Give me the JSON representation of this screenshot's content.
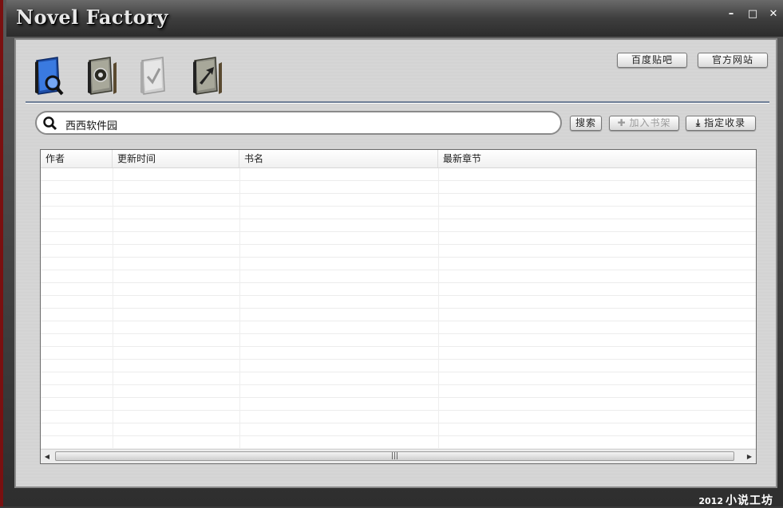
{
  "app": {
    "title": "Novel Factory",
    "window_controls": {
      "minimize": "–",
      "maximize": "□",
      "close": "✕"
    }
  },
  "toolbar": {
    "tools": [
      {
        "name": "search-tool",
        "icon": "book-magnifier-icon",
        "color": "#2a62c8"
      },
      {
        "name": "bookshelf-tool",
        "icon": "book-gear-icon",
        "color": "#7a6a4a"
      },
      {
        "name": "check-tool",
        "icon": "book-check-icon",
        "color": "#b8b8b8"
      },
      {
        "name": "export-tool",
        "icon": "book-arrow-icon",
        "color": "#7a6a4a"
      }
    ],
    "links": {
      "tieba": "百度贴吧",
      "official_site": "官方网站"
    }
  },
  "search": {
    "value": "西西软件园",
    "buttons": {
      "search": "搜索",
      "add_to_shelf": "加入书架",
      "specify": "指定收录"
    }
  },
  "table": {
    "columns": [
      "作者",
      "更新时间",
      "书名",
      "最新章节"
    ],
    "rows": []
  },
  "footer": {
    "year": "2012",
    "name": "小说工坊"
  }
}
